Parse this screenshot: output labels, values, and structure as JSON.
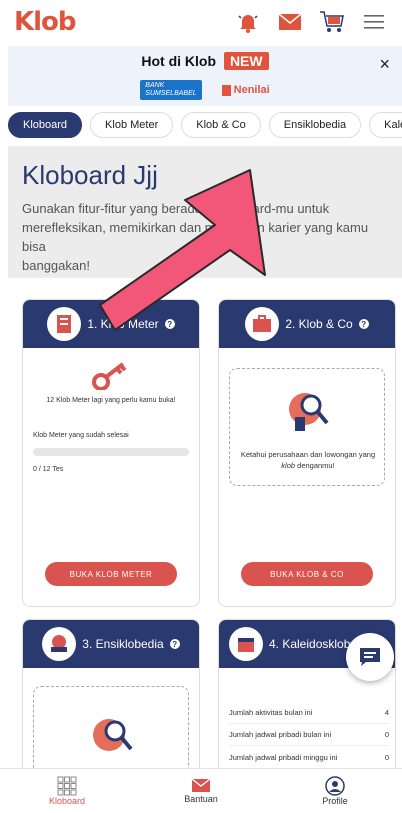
{
  "app": {
    "logo": "Klob"
  },
  "promo": {
    "title": "Hot di Klob",
    "badge": "NEW",
    "bank_logo_line1": "BANK",
    "bank_logo_line2": "SUMSELBABEL",
    "partner": "Nenilai",
    "close": "×"
  },
  "tabs": [
    {
      "label": "Kloboard",
      "active": true
    },
    {
      "label": "Klob Meter"
    },
    {
      "label": "Klob & Co"
    },
    {
      "label": "Ensiklobedia"
    },
    {
      "label": "Kaleidosklob"
    }
  ],
  "hero": {
    "title": "Kloboard Jjj",
    "desc_line1": "Gunakan fitur-fitur yang berada di Kloboard-mu untuk",
    "desc_line2": "merefleksikan, memikirkan dan menyusun karier yang kamu bisa",
    "desc_line3": "banggakan!"
  },
  "cards": {
    "meter": {
      "title": "1. Klob Meter",
      "remaining": "12 Klob Meter lagi yang perlu kamu buka!",
      "done_label": "Klob Meter yang sudah selesai",
      "progress_text": "0 / 12 Tes",
      "progress": 0,
      "button": "BUKA KLOB METER"
    },
    "co": {
      "title": "2. Klob & Co",
      "desc_pre": "Ketahui perusahaan dan lowongan yang",
      "desc_em": "klob",
      "desc_post": "denganmu!",
      "button": "BUKA KLOB & CO"
    },
    "ensiklo": {
      "title": "3. Ensiklobedia"
    },
    "kaleido": {
      "title": "4. Kaleidosklob",
      "rows": [
        {
          "label": "Jumlah aktivitas bulan ini",
          "value": "4"
        },
        {
          "label": "Jumlah jadwal pribadi bulan ini",
          "value": "0"
        },
        {
          "label": "Jumlah jadwal pribadi minggu ini",
          "value": "0"
        }
      ]
    }
  },
  "bottom_nav": [
    {
      "label": "Kloboard",
      "active": true
    },
    {
      "label": "Bantuan"
    },
    {
      "label": "Profile"
    }
  ],
  "colors": {
    "brand": "#e0533d",
    "navy": "#2a3970",
    "button": "#d9534f"
  }
}
